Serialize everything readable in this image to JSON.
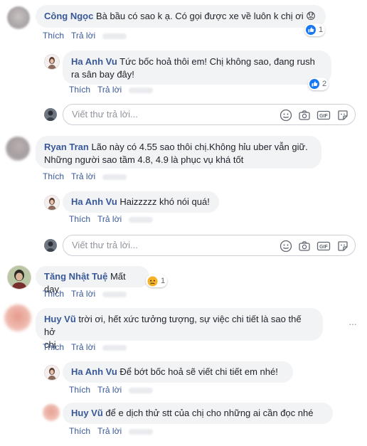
{
  "comments": [
    {
      "author": "Công Ngọc",
      "text": "Bà bầu có sao k ạ. Có gọi được xe về luôn k chị ơi",
      "emoji": "😟",
      "reaction": {
        "icon": "like-icon",
        "color": "#1877f2",
        "count": "1"
      },
      "actions": {
        "like": "Thích",
        "reply": "Trả lời"
      },
      "replies": [
        {
          "author": "Ha Anh Vu",
          "text_line1": "Tức bốc hoả thôi em! Chị không sao, đang rush",
          "text_line2": "ra sân bay đây!",
          "reaction": {
            "icon": "like-icon",
            "color": "#1877f2",
            "count": "2"
          },
          "actions": {
            "like": "Thích",
            "reply": "Trả lời"
          }
        }
      ],
      "reply_box": {
        "placeholder": "Viết thư trả lời..."
      }
    },
    {
      "author": "Ryan Tran",
      "text_line1": "Lão này có 4.55 sao thôi chị.Không hỉu uber vẫn giữ.",
      "text_line2": "Những người sao tầm 4.8, 4.9 là phục vụ khá tốt",
      "actions": {
        "like": "Thích",
        "reply": "Trả lời"
      },
      "replies": [
        {
          "author": "Ha Anh Vu",
          "text": "Haizzzzz khó nói quá!",
          "actions": {
            "like": "Thích",
            "reply": "Trả lời"
          }
        }
      ],
      "reply_box": {
        "placeholder": "Viết thư trả lời..."
      }
    },
    {
      "author": "Tăng Nhật Tuệ",
      "text": "Mất dạy",
      "reaction": {
        "icon": "sad-icon",
        "color": "#f7b125",
        "count": "1"
      },
      "actions": {
        "like": "Thích",
        "reply": "Trả lời"
      }
    },
    {
      "author": "Huy Vũ",
      "text_line1": "trời ơi, hết xức tưởng tượng, sự việc chi tiết là sao thế hở",
      "text_line2": "chị",
      "menu": "···",
      "actions": {
        "like": "Thích",
        "reply": "Trả lời"
      },
      "replies": [
        {
          "author": "Ha Anh Vu",
          "text": "Để bớt bốc hoả sẽ viết chi tiết em nhé!",
          "actions": {
            "like": "Thích",
            "reply": "Trả lời"
          }
        },
        {
          "author": "Huy Vũ",
          "text": "để e dịch thử stt của chị cho những ai cần đọc nhé",
          "actions": {
            "like": "Thích",
            "reply": "Trả lời"
          }
        }
      ]
    }
  ],
  "tool_icons": [
    "emoji-icon",
    "camera-icon",
    "gif-icon",
    "sticker-icon"
  ],
  "colors": {
    "link": "#385898",
    "bubble": "#f2f3f5",
    "meta": "#90949c",
    "like_blue": "#1877f2"
  }
}
